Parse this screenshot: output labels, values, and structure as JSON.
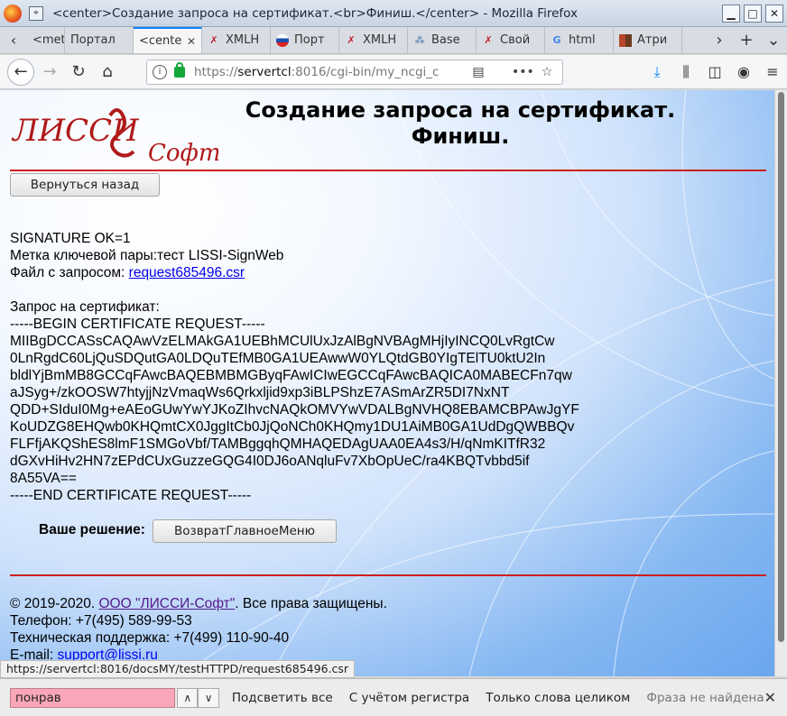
{
  "window": {
    "title": "<center>Создание запроса на сертификат.<br>Финиш.</center> - Mozilla Firefox"
  },
  "tabs": [
    {
      "label": "<meta",
      "icon": "none",
      "active": false
    },
    {
      "label": "Портал",
      "icon": "none",
      "active": false
    },
    {
      "label": "<cente",
      "icon": "none",
      "active": true
    },
    {
      "label": "XMLH",
      "icon": "x-icon",
      "active": false
    },
    {
      "label": "Порт",
      "icon": "flag-icon",
      "active": false
    },
    {
      "label": "XMLH",
      "icon": "x-icon",
      "active": false
    },
    {
      "label": "Base",
      "icon": "node-icon",
      "active": false
    },
    {
      "label": "Свой",
      "icon": "x-icon",
      "active": false
    },
    {
      "label": "html",
      "icon": "google-icon",
      "active": false
    },
    {
      "label": "Атри",
      "icon": "blocks-icon",
      "active": false
    }
  ],
  "url": {
    "scheme": "https://",
    "host": "servertcl",
    "path": ":8016/cgi-bin/my_ncgi_c"
  },
  "page": {
    "logo_text": "ЛИССИ",
    "logo_sub": "Софт",
    "title_line1": "Создание запроса на сертификат.",
    "title_line2": "Финиш.",
    "back_button": "Вернуться назад",
    "signature": "SIGNATURE OK=1",
    "key_label": "Метка ключевой пары:тест LISSI-SignWeb",
    "file_label": "Файл с запросом: ",
    "file_link": " request685496.csr",
    "request_label": "Запрос на сертификат:",
    "csr_lines": [
      "-----BEGIN CERTIFICATE REQUEST-----",
      "MIIBgDCCASsCAQAwVzELMAkGA1UEBhMCUlUxJzAlBgNVBAgMHjIyINCQ0LvRgtCw",
      "0LnRgdC60LjQuSDQutGA0LDQuTEfMB0GA1UEAwwW0YLQtdGB0YIgTElTU0ktU2In",
      "bldlYjBmMB8GCCqFAwcBAQEBMBMGByqFAwICIwEGCCqFAwcBAQICA0MABECFn7qw",
      "aJSyg+/zkOOSW7htyjjNzVmaqWs6Qrkxljid9xp3iBLPShzE7ASmArZR5DI7NxNT",
      "QDD+SIduI0Mg+eAEoGUwYwYJKoZIhvcNAQkOMVYwVDALBgNVHQ8EBAMCBPAwJgYF",
      "KoUDZG8EHQwb0KHQmtCX0JggItCb0JjQoNCh0KHQmy1DU1AiMB0GA1UdDgQWBBQv",
      "FLFfjAKQShES8lmF1SMGoVbf/TAMBggqhQMHAQEDAgUAA0EA4s3/H/qNmKITfR32",
      "dGXvHiHv2HN7zEPdCUxGuzzeGQG4I0DJ6oANqluFv7XbOpUeC/ra4KBQTvbbd5if",
      "8A55VA==",
      "-----END CERTIFICATE REQUEST-----"
    ],
    "decision_label": "Ваше решение:",
    "decision_button": "ВозвратГлавноеМеню"
  },
  "footer": {
    "copyright_pre": "© 2019-2020. ",
    "company_link": "ООО \"ЛИССИ-Софт\"",
    "copyright_post": ". Все права защищены.",
    "phone": "Телефон: +7(495) 589-99-53",
    "support": "Техническая поддержка: +7(499) 110-90-40",
    "email_label": "E-mail: ",
    "email_link": " support@lissi.ru"
  },
  "status_url": "https://servertcl:8016/docsMY/testHTTPD/request685496.csr",
  "findbar": {
    "query": "понрав",
    "highlight_all": "Подсветить все",
    "match_case": "С учётом регистра",
    "whole_words": "Только слова целиком",
    "status": "Фраза не найдена"
  },
  "colors": {
    "accent": "#0a84ff",
    "rule": "#cc1f1f",
    "find_notfound": "#f9a7b8",
    "logo": "#b01a1a"
  }
}
